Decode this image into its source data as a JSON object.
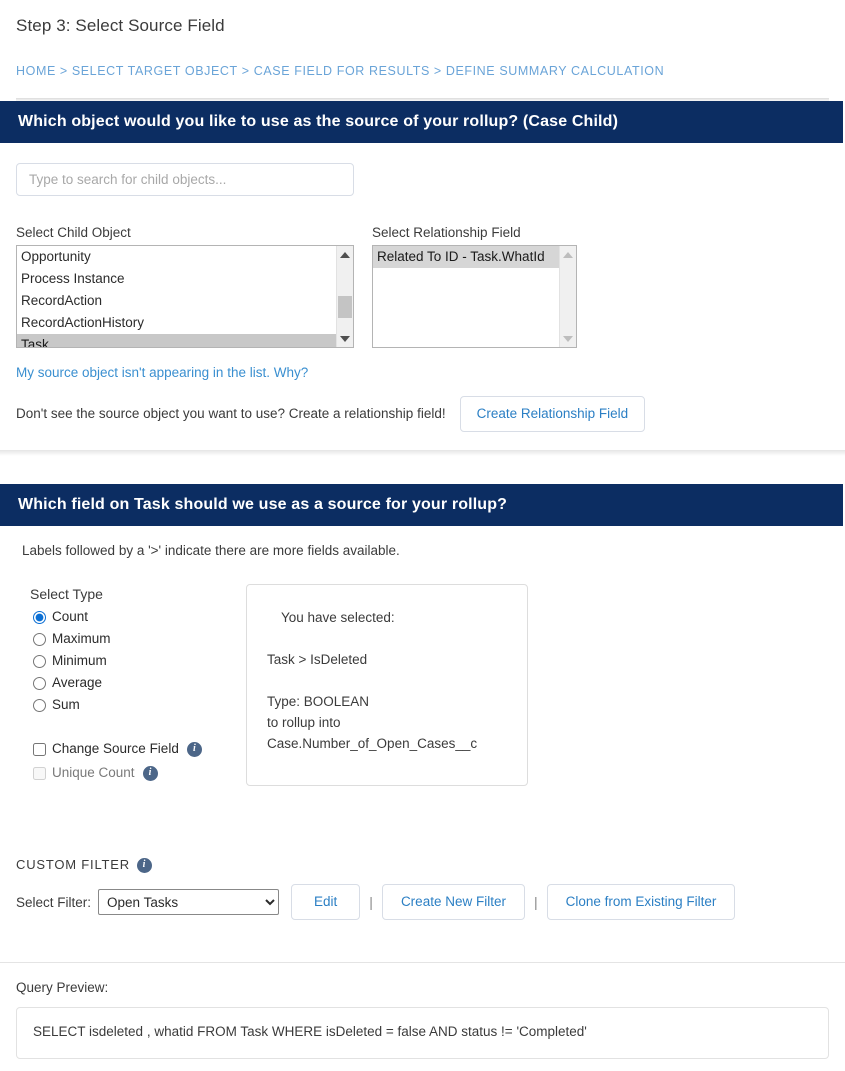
{
  "page": {
    "step_title": "Step 3: Select Source Field"
  },
  "breadcrumb": {
    "items": [
      "HOME",
      "SELECT TARGET OBJECT",
      "CASE FIELD FOR RESULTS",
      "DEFINE SUMMARY CALCULATION"
    ],
    "separator": ">"
  },
  "section_source": {
    "header": "Which object would you like to use as the source of your rollup? (Case Child)",
    "search_placeholder": "Type to search for child objects...",
    "search_value": "",
    "child_object_label": "Select Child Object",
    "child_objects": [
      "Opportunity",
      "Process Instance",
      "RecordAction",
      "RecordActionHistory",
      "Task"
    ],
    "child_selected": "Task",
    "relationship_label": "Select Relationship Field",
    "relationship_fields": [
      "Related To ID - Task.WhatId"
    ],
    "relationship_selected": "Related To ID - Task.WhatId",
    "help_link": "My source object isn't appearing in the list. Why?",
    "relationship_hint": "Don't see the source object you want to use? Create a relationship field!",
    "create_relationship_button": "Create Relationship Field"
  },
  "section_field": {
    "header": "Which field on Task should we use as a source for your rollup?",
    "hint": "Labels followed by a '>' indicate there are more fields available.",
    "select_type_label": "Select Type",
    "types": [
      {
        "label": "Count",
        "checked": true
      },
      {
        "label": "Maximum",
        "checked": false
      },
      {
        "label": "Minimum",
        "checked": false
      },
      {
        "label": "Average",
        "checked": false
      },
      {
        "label": "Sum",
        "checked": false
      }
    ],
    "checkboxes": [
      {
        "label": "Change Source Field",
        "checked": false,
        "disabled": false,
        "info": "info-icon"
      },
      {
        "label": "Unique Count",
        "checked": false,
        "disabled": true,
        "info": "info-icon"
      }
    ],
    "selected_panel": {
      "heading": "You have selected:",
      "field_path": "Task > IsDeleted",
      "type_line": "Type: BOOLEAN",
      "rollup_line": "to rollup into",
      "target_line": "Case.Number_of_Open_Cases__c"
    }
  },
  "custom_filter": {
    "title": "CUSTOM FILTER",
    "select_label": "Select Filter:",
    "selected_filter": "Open Tasks",
    "filter_options": [
      "Open Tasks"
    ],
    "edit_button": "Edit",
    "create_button": "Create New Filter",
    "clone_button": "Clone from Existing Filter",
    "divider": "|"
  },
  "query_preview": {
    "label": "Query Preview:",
    "query": "SELECT isdeleted , whatid FROM Task WHERE isDeleted = false AND status != 'Completed'"
  },
  "colors": {
    "header_blue": "#0c2d62",
    "link_blue": "#3a8fd0",
    "breadcrumb_blue": "#6aa4d8",
    "info_icon": "#4c6688",
    "radio_accent": "#0b6fd4"
  }
}
